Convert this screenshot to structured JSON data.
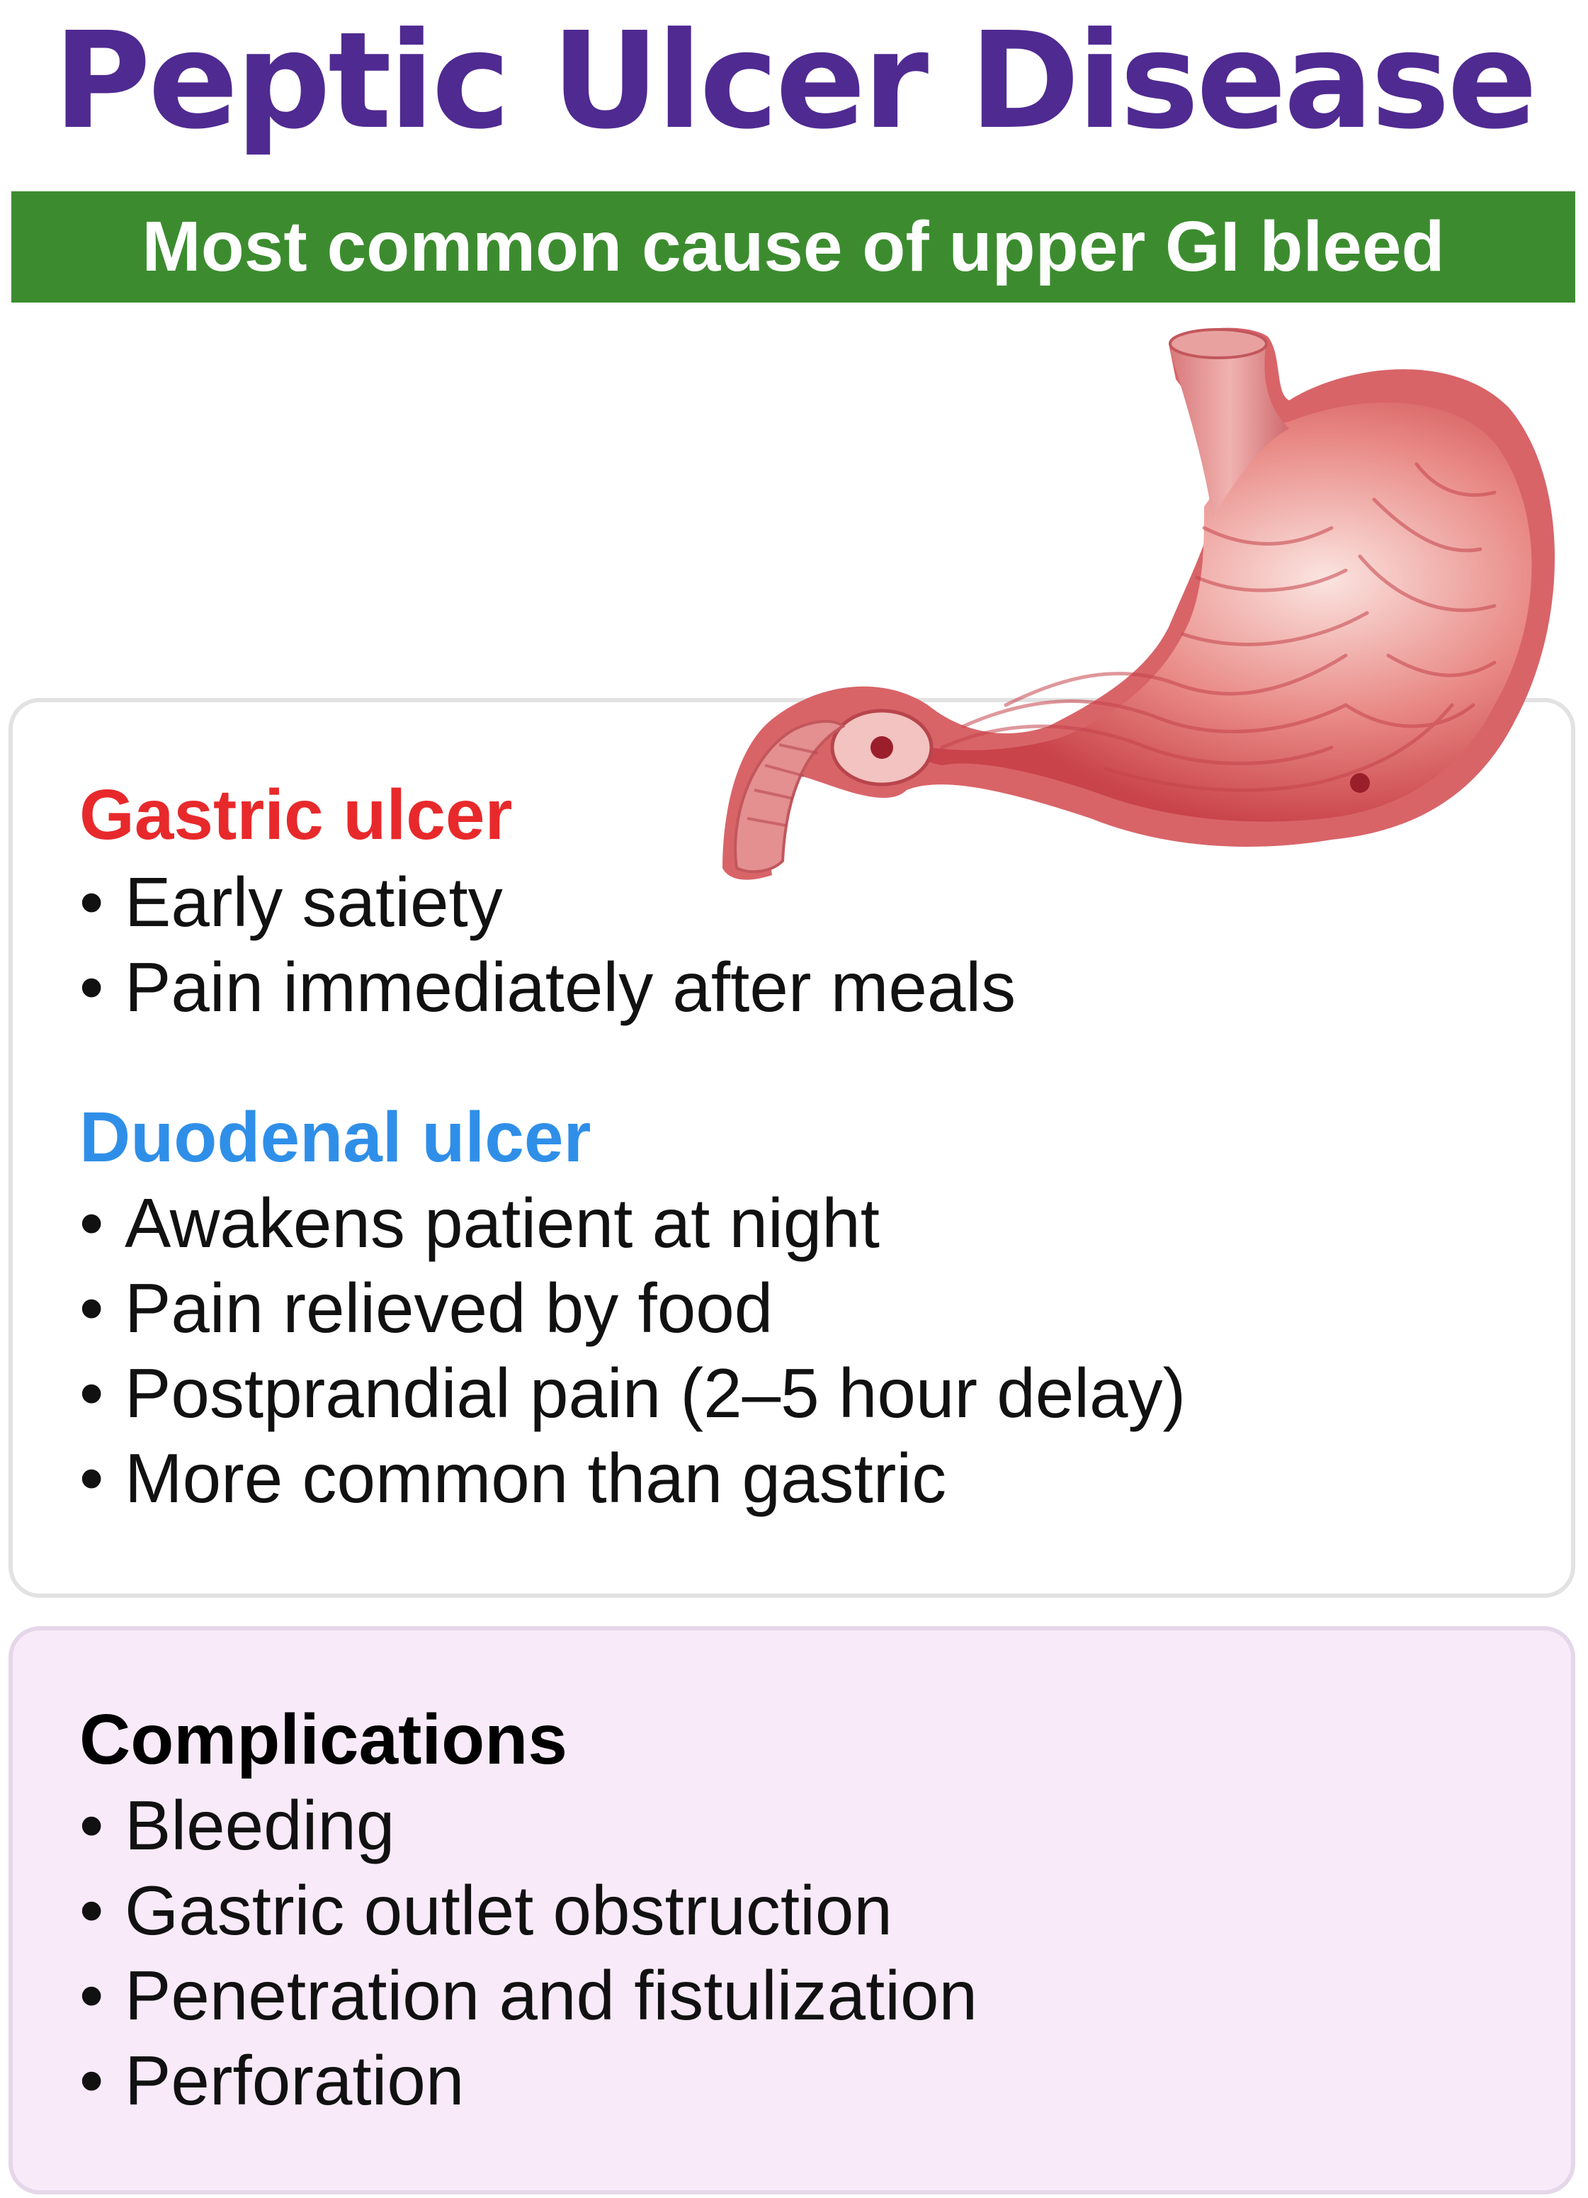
{
  "title": "Peptic Ulcer Disease",
  "banner": "Most common cause of upper GI bleed",
  "colors": {
    "title": "#4f2a91",
    "banner_bg": "#3c8c2f",
    "gastric_heading": "#e8292b",
    "duodenal_heading": "#2f8fe8",
    "complications_bg": "#f9eafa"
  },
  "illustration": "stomach-cross-section",
  "gastric": {
    "heading": "Gastric ulcer",
    "items": [
      "Early satiety",
      "Pain immediately after meals"
    ]
  },
  "duodenal": {
    "heading": "Duodenal ulcer",
    "items": [
      "Awakens patient at night",
      "Pain relieved by food",
      "Postprandial pain (2–5 hour delay)",
      "More common than gastric"
    ]
  },
  "complications": {
    "heading": "Complications",
    "items": [
      "Bleeding",
      "Gastric outlet obstruction",
      "Penetration and fistulization",
      "Perforation"
    ]
  },
  "bullet": "•"
}
